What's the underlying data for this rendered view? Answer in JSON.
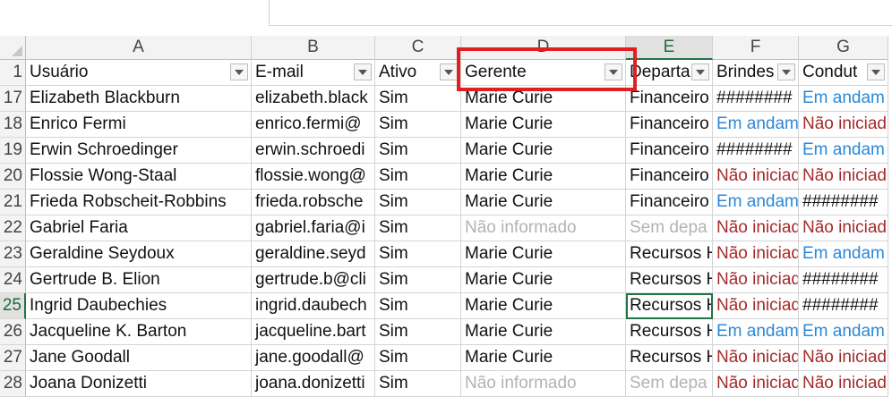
{
  "columns": [
    "A",
    "B",
    "C",
    "D",
    "E",
    "F",
    "G"
  ],
  "selected_column": "E",
  "selected_row": "25",
  "header_row": {
    "row_number": "1",
    "cells": [
      "Usuário",
      "E-mail",
      "Ativo",
      "Gerente",
      "Departa",
      "Brindes",
      "Condut"
    ]
  },
  "rows": [
    {
      "num": "17",
      "cells": [
        "Elizabeth Blackburn",
        "elizabeth.black",
        "Sim",
        "Marie Curie",
        "Financeiro",
        "########",
        "Em andam"
      ],
      "styles": [
        "",
        "",
        "",
        "",
        "",
        "",
        "blue"
      ]
    },
    {
      "num": "18",
      "cells": [
        "Enrico Fermi",
        "enrico.fermi@",
        "Sim",
        "Marie Curie",
        "Financeiro",
        "Em andam",
        "Não iniciad"
      ],
      "styles": [
        "",
        "",
        "",
        "",
        "",
        "blue",
        "red"
      ]
    },
    {
      "num": "19",
      "cells": [
        "Erwin Schroedinger",
        "erwin.schroedi",
        "Sim",
        "Marie Curie",
        "Financeiro",
        "########",
        "Em andam"
      ],
      "styles": [
        "",
        "",
        "",
        "",
        "",
        "",
        "blue"
      ]
    },
    {
      "num": "20",
      "cells": [
        "Flossie Wong-Staal",
        "flossie.wong@",
        "Sim",
        "Marie Curie",
        "Financeiro",
        "Não iniciad",
        "Não iniciad"
      ],
      "styles": [
        "",
        "",
        "",
        "",
        "",
        "red",
        "red"
      ]
    },
    {
      "num": "21",
      "cells": [
        "Frieda Robscheit-Robbins",
        "frieda.robsche",
        "Sim",
        "Marie Curie",
        "Financeiro",
        "Em andam",
        "########"
      ],
      "styles": [
        "",
        "",
        "",
        "",
        "",
        "blue",
        ""
      ]
    },
    {
      "num": "22",
      "cells": [
        "Gabriel Faria",
        "gabriel.faria@i",
        "Sim",
        "Não informado",
        "Sem depa",
        "Não iniciad",
        "Não iniciad"
      ],
      "styles": [
        "",
        "",
        "",
        "muted",
        "muted",
        "red",
        "red"
      ]
    },
    {
      "num": "23",
      "cells": [
        "Geraldine Seydoux",
        "geraldine.seyd",
        "Sim",
        "Marie Curie",
        "Recursos H",
        "Não iniciad",
        "Em andam"
      ],
      "styles": [
        "",
        "",
        "",
        "",
        "",
        "red",
        "blue"
      ]
    },
    {
      "num": "24",
      "cells": [
        "Gertrude B. Elion",
        "gertrude.b@cli",
        "Sim",
        "Marie Curie",
        "Recursos H",
        "Não iniciad",
        "########"
      ],
      "styles": [
        "",
        "",
        "",
        "",
        "",
        "red",
        ""
      ]
    },
    {
      "num": "25",
      "cells": [
        "Ingrid Daubechies",
        "ingrid.daubech",
        "Sim",
        "Marie Curie",
        "Recursos H",
        "Não iniciad",
        "########"
      ],
      "styles": [
        "",
        "",
        "",
        "",
        "",
        "red",
        ""
      ]
    },
    {
      "num": "26",
      "cells": [
        "Jacqueline K. Barton",
        "jacqueline.bart",
        "Sim",
        "Marie Curie",
        "Recursos H",
        "Em andam",
        "Em andam"
      ],
      "styles": [
        "",
        "",
        "",
        "",
        "",
        "blue",
        "blue"
      ]
    },
    {
      "num": "27",
      "cells": [
        "Jane Goodall",
        "jane.goodall@",
        "Sim",
        "Marie Curie",
        "Recursos H",
        "Não iniciad",
        "Não iniciad"
      ],
      "styles": [
        "",
        "",
        "",
        "",
        "",
        "red",
        "red"
      ]
    },
    {
      "num": "28",
      "cells": [
        "Joana Donizetti",
        "joana.donizetti",
        "Sim",
        "Não informado",
        "Sem depa",
        "Não iniciad",
        "Não iniciad"
      ],
      "styles": [
        "",
        "",
        "",
        "muted",
        "muted",
        "red",
        "red"
      ]
    }
  ],
  "colors": {
    "accent_green": "#217346",
    "highlight_red": "#e02020",
    "link_blue": "#2b88d8",
    "status_red": "#a52a2a",
    "muted_gray": "#b3b3b3"
  }
}
